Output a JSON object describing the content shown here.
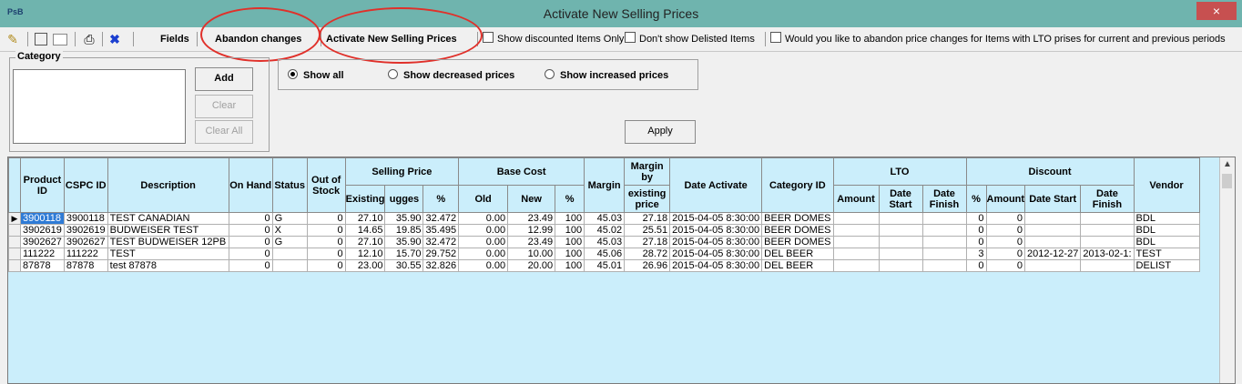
{
  "window": {
    "logo": "PsB",
    "title": "Activate New Selling Prices",
    "close": "×"
  },
  "toolbar": {
    "icons": [
      "wand-icon",
      "preview-icon",
      "blank-icon",
      "print-icon",
      "close-x-icon"
    ],
    "fields": "Fields",
    "abandon": "Abandon  changes",
    "activate": "Activate New Selling Prices",
    "chk_discounted": "Show discounted Items Only",
    "chk_delisted": "Don't show Delisted Items",
    "chk_lto": "Would you like to abandon price changes for Items with LTO prises for current and previous periods"
  },
  "category": {
    "legend": "Category",
    "add": "Add",
    "clear": "Clear",
    "clear_all": "Clear All"
  },
  "filter": {
    "show_all": "Show all",
    "show_decreased": "Show decreased prices",
    "show_increased": "Show increased prices",
    "selected": "show_all",
    "apply": "Apply"
  },
  "grid": {
    "headers": {
      "product_id": "Product ID",
      "cspc_id": "CSPC ID",
      "description": "Description",
      "on_hand": "On Hand",
      "status": "Status",
      "out_of_stock": "Out of Stock",
      "selling_price": "Selling Price",
      "existing": "Existing",
      "suggested": "ugges",
      "pct": "%",
      "base_cost": "Base Cost",
      "old": "Old",
      "new": "New",
      "margin": "Margin",
      "margin_by": "Margin by",
      "existing_price": "existing price",
      "date_activate": "Date Activate",
      "category_id": "Category ID",
      "lto": "LTO",
      "amount": "Amount",
      "date_start": "Date Start",
      "date_finish": "Date Finish",
      "discount": "Discount",
      "vendor": "Vendor"
    },
    "rows": [
      [
        "3900118",
        "3900118",
        "TEST CANADIAN",
        "0",
        "G",
        "0",
        "27.10",
        "35.90",
        "32.472",
        "0.00",
        "23.49",
        "100",
        "45.03",
        "27.18",
        "2015-04-05 8:30:00",
        "BEER DOMES",
        "",
        "",
        "",
        "0",
        "0",
        "",
        "",
        "BDL"
      ],
      [
        "3902619",
        "3902619",
        "BUDWEISER TEST",
        "0",
        "X",
        "0",
        "14.65",
        "19.85",
        "35.495",
        "0.00",
        "12.99",
        "100",
        "45.02",
        "25.51",
        "2015-04-05 8:30:00",
        "BEER DOMES",
        "",
        "",
        "",
        "0",
        "0",
        "",
        "",
        "BDL"
      ],
      [
        "3902627",
        "3902627",
        "TEST BUDWEISER 12PB",
        "0",
        "G",
        "0",
        "27.10",
        "35.90",
        "32.472",
        "0.00",
        "23.49",
        "100",
        "45.03",
        "27.18",
        "2015-04-05 8:30:00",
        "BEER DOMES",
        "",
        "",
        "",
        "0",
        "0",
        "",
        "",
        "BDL"
      ],
      [
        "111222",
        "111222",
        "TEST",
        "0",
        "",
        "0",
        "12.10",
        "15.70",
        "29.752",
        "0.00",
        "10.00",
        "100",
        "45.06",
        "28.72",
        "2015-04-05 8:30:00",
        "DEL BEER",
        "",
        "",
        "",
        "3",
        "0",
        "2012-12-27",
        "2013-02-1:",
        "TEST"
      ],
      [
        "87878",
        "87878",
        "test 87878",
        "0",
        "",
        "0",
        "23.00",
        "30.55",
        "32.826",
        "0.00",
        "20.00",
        "100",
        "45.01",
        "26.96",
        "2015-04-05 8:30:00",
        "DEL BEER",
        "",
        "",
        "",
        "0",
        "0",
        "",
        "",
        "DELIST"
      ]
    ]
  }
}
